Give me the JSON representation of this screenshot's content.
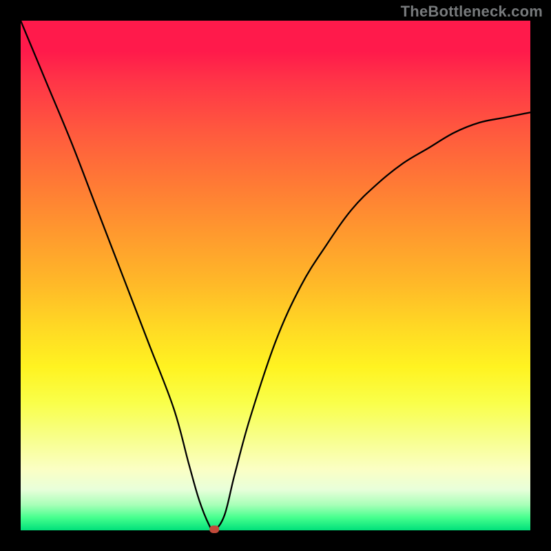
{
  "watermark": "TheBottleneck.com",
  "chart_data": {
    "type": "line",
    "title": "",
    "xlabel": "",
    "ylabel": "",
    "xlim": [
      0,
      100
    ],
    "ylim": [
      0,
      100
    ],
    "grid": false,
    "legend": false,
    "background_gradient": {
      "direction": "vertical",
      "stops": [
        {
          "pct": 0,
          "color": "#ff1a4b"
        },
        {
          "pct": 50,
          "color": "#ffba28"
        },
        {
          "pct": 75,
          "color": "#f9ff4a"
        },
        {
          "pct": 92,
          "color": "#e8ffda"
        },
        {
          "pct": 100,
          "color": "#00e07a"
        }
      ]
    },
    "series": [
      {
        "name": "bottleneck-curve",
        "x": [
          0,
          5,
          10,
          15,
          20,
          25,
          30,
          33,
          35,
          37,
          38,
          40,
          42,
          45,
          50,
          55,
          60,
          65,
          70,
          75,
          80,
          85,
          90,
          95,
          100
        ],
        "y": [
          100,
          88,
          76,
          63,
          50,
          37,
          24,
          13,
          6,
          1,
          0,
          3,
          11,
          22,
          37,
          48,
          56,
          63,
          68,
          72,
          75,
          78,
          80,
          81,
          82
        ]
      }
    ],
    "marker": {
      "x": 38,
      "y": 0,
      "color": "#c24a3a"
    },
    "watermark_text": "TheBottleneck.com"
  }
}
